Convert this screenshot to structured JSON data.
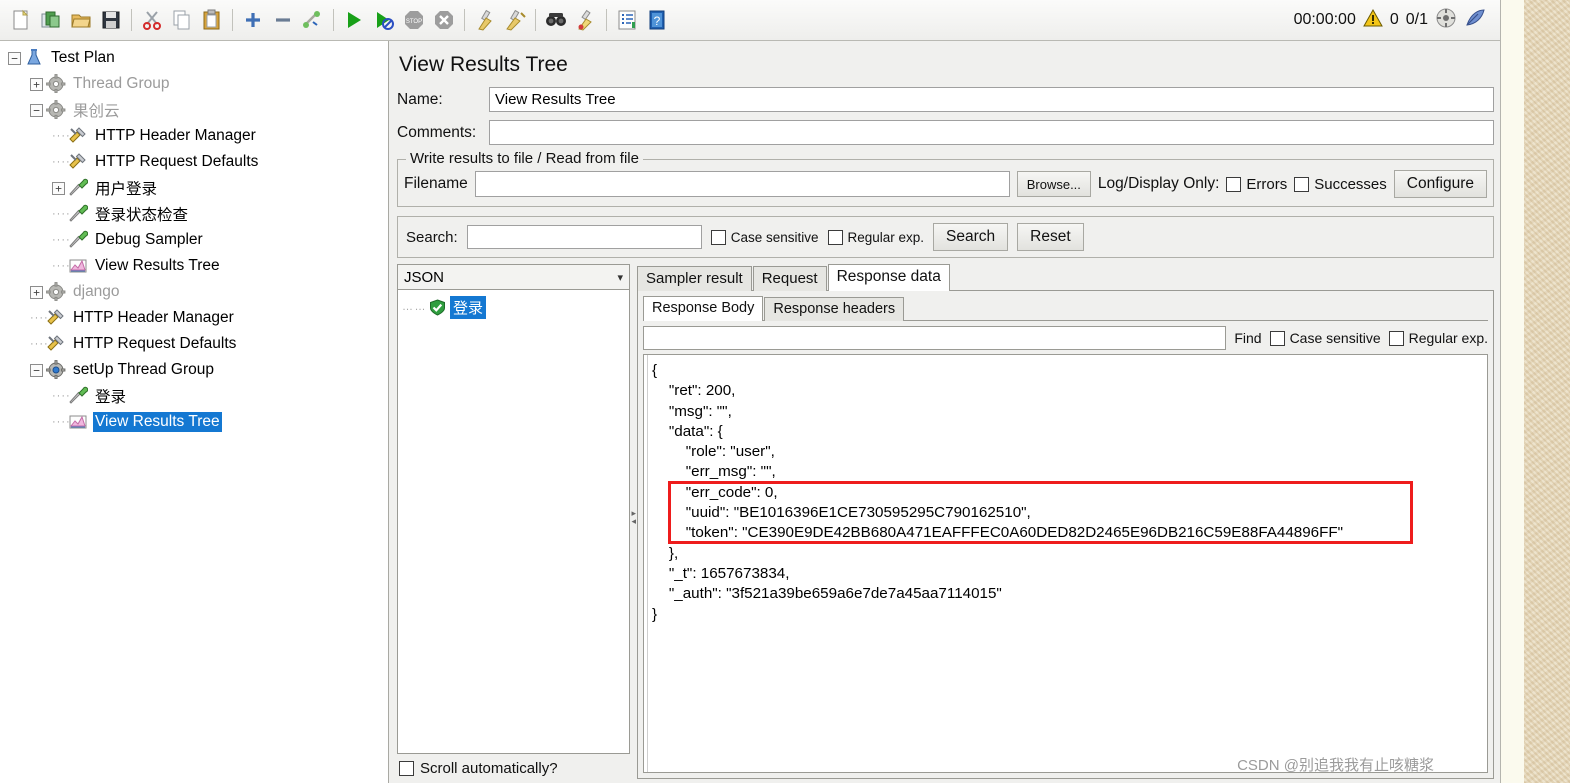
{
  "window": {
    "toolbar_icons": [
      "new-file-icon",
      "open-template-icon",
      "open-folder-icon",
      "save-icon",
      "cut-icon",
      "copy-icon",
      "paste-icon",
      "expand-all-icon",
      "collapse-all-icon",
      "toggle-icon",
      "start-icon",
      "start-no-pauses-icon",
      "stop-icon",
      "shutdown-icon",
      "clear-icon",
      "clear-all-icon",
      "search-icon",
      "search-reset-icon",
      "function-helper-icon",
      "help-icon"
    ],
    "status": {
      "elapsed": "00:00:00",
      "warning_icon": "warning-triangle-icon",
      "warning_count": "0",
      "threads": "0/1",
      "stats_icon": "thread-status-icon",
      "logo_icon": "jmeter-feather-icon"
    }
  },
  "tree": {
    "nodes": [
      {
        "label": "Test Plan",
        "indent": 0,
        "handle": "minus",
        "icon": "test-plan-icon",
        "state": "normal"
      },
      {
        "label": "Thread Group",
        "indent": 1,
        "handle": "plus",
        "icon": "thread-group-icon",
        "state": "disabled"
      },
      {
        "label": "果创云",
        "indent": 1,
        "handle": "minus",
        "icon": "thread-group-icon",
        "state": "disabled"
      },
      {
        "label": "HTTP Header Manager",
        "indent": 2,
        "handle": "none",
        "icon": "config-element-icon",
        "state": "normal"
      },
      {
        "label": "HTTP Request Defaults",
        "indent": 2,
        "handle": "none",
        "icon": "config-element-icon",
        "state": "normal"
      },
      {
        "label": "用户登录",
        "indent": 2,
        "handle": "plus",
        "icon": "sampler-icon",
        "state": "normal"
      },
      {
        "label": "登录状态检查",
        "indent": 2,
        "handle": "none",
        "icon": "sampler-icon",
        "state": "normal"
      },
      {
        "label": "Debug Sampler",
        "indent": 2,
        "handle": "none",
        "icon": "sampler-icon",
        "state": "normal"
      },
      {
        "label": "View Results Tree",
        "indent": 2,
        "handle": "none",
        "icon": "listener-icon",
        "state": "normal"
      },
      {
        "label": "django",
        "indent": 1,
        "handle": "plus",
        "icon": "thread-group-icon",
        "state": "disabled"
      },
      {
        "label": "HTTP Header Manager",
        "indent": 1,
        "handle": "none",
        "icon": "config-element-icon",
        "state": "normal"
      },
      {
        "label": "HTTP Request Defaults",
        "indent": 1,
        "handle": "none",
        "icon": "config-element-icon",
        "state": "normal"
      },
      {
        "label": "setUp Thread Group",
        "indent": 1,
        "handle": "minus",
        "icon": "setup-thread-group-icon",
        "state": "normal"
      },
      {
        "label": "登录",
        "indent": 2,
        "handle": "none",
        "icon": "sampler-icon",
        "state": "normal"
      },
      {
        "label": "View Results Tree",
        "indent": 2,
        "handle": "none",
        "icon": "listener-icon",
        "state": "selected"
      }
    ]
  },
  "panel": {
    "title": "View Results Tree",
    "name_label": "Name:",
    "name_value": "View Results Tree",
    "comments_label": "Comments:",
    "comments_value": "",
    "file_group": {
      "title": "Write results to file / Read from file",
      "filename_label": "Filename",
      "filename_value": "",
      "browse_label": "Browse...",
      "logdisplay_label": "Log/Display Only:",
      "errors_label": "Errors",
      "errors_checked": false,
      "successes_label": "Successes",
      "successes_checked": false,
      "configure_label": "Configure"
    },
    "search_bar": {
      "label": "Search:",
      "value": "",
      "case_sensitive_label": "Case sensitive",
      "case_sensitive_checked": false,
      "regular_exp_label": "Regular exp.",
      "regular_exp_checked": false,
      "search_button": "Search",
      "reset_button": "Reset"
    }
  },
  "results": {
    "renderer_selected": "JSON",
    "renderer_chevron": "chevron-down-icon",
    "entries": [
      {
        "label": "登录",
        "status_icon": "success-shield-icon",
        "selected": true
      }
    ],
    "scroll_auto_label": "Scroll automatically?",
    "scroll_auto_checked": false,
    "tabs": [
      {
        "label": "Sampler result",
        "active": false
      },
      {
        "label": "Request",
        "active": false
      },
      {
        "label": "Response data",
        "active": true
      }
    ],
    "inner_tabs": [
      {
        "label": "Response Body",
        "active": true
      },
      {
        "label": "Response headers",
        "active": false
      }
    ],
    "find_bar": {
      "value": "",
      "find_label": "Find",
      "case_sensitive_label": "Case sensitive",
      "case_sensitive_checked": false,
      "regular_exp_label": "Regular exp.",
      "regular_exp_checked": false
    },
    "response_body": "{\n    \"ret\": 200,\n    \"msg\": \"\",\n    \"data\": {\n        \"role\": \"user\",\n        \"err_msg\": \"\",\n        \"err_code\": 0,\n        \"uuid\": \"BE1016396E1CE730595295C790162510\",\n        \"token\": \"CE390E9DE42BB680A471EAFFFEC0A60DED82D2465E96DB216C59E88FA44896FF\"\n    },\n    \"_t\": 1657673834,\n    \"_auth\": \"3f521a39be659a6e7de7a45aa7114015\"\n}",
    "annotation": {
      "shape": "rectangle",
      "color": "#ee1c1c"
    }
  },
  "watermark": "CSDN @别追我我有止咳糖浆"
}
